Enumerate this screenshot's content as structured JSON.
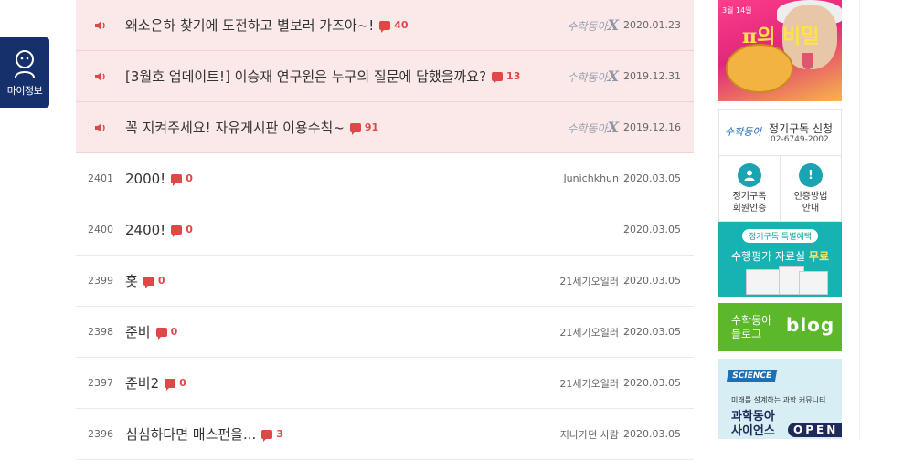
{
  "myinfo": {
    "label": "마이정보"
  },
  "notices": [
    {
      "title": "왜소은하 찾기에 도전하고 별보러 가즈아~!",
      "comments": "40",
      "date": "2020.01.23"
    },
    {
      "title": "[3월호 업데이트!] 이승재 연구원은 누구의 질문에 답했을까요?",
      "comments": "13",
      "date": "2019.12.31"
    },
    {
      "title": "꼭 지켜주세요! 자유게시판 이용수칙~",
      "comments": "91",
      "date": "2019.12.16"
    }
  ],
  "notice_logo": {
    "text": "수학동아",
    "mark": "X"
  },
  "posts": [
    {
      "num": "2401",
      "title": "2000!",
      "comments": "0",
      "author": "Junichkhun",
      "date": "2020.03.05"
    },
    {
      "num": "2400",
      "title": "2400!",
      "comments": "0",
      "author": "",
      "date": "2020.03.05"
    },
    {
      "num": "2399",
      "title": "홋",
      "comments": "0",
      "author": "21세기오일러",
      "date": "2020.03.05"
    },
    {
      "num": "2398",
      "title": "준비",
      "comments": "0",
      "author": "21세기오일러",
      "date": "2020.03.05"
    },
    {
      "num": "2397",
      "title": "준비2",
      "comments": "0",
      "author": "21세기오일러",
      "date": "2020.03.05"
    },
    {
      "num": "2396",
      "title": "심심하다면 매스펀을...",
      "comments": "3",
      "author": "지나가던 사람",
      "date": "2020.03.05"
    }
  ],
  "sidebar": {
    "cover": {
      "line1": "3월 14일",
      "line2": "π의 비밀",
      "pi": "π"
    },
    "subscription": {
      "brand": "수학동아",
      "title": "정기구독 신청",
      "phone": "02-6749-2002",
      "left": {
        "l1": "정기구독",
        "l2": "회원인증"
      },
      "right": {
        "l1": "인증방법",
        "l2": "안내"
      }
    },
    "perk": {
      "pill": "정기구독 특별혜택",
      "title_a": "수행평가 자료실 ",
      "title_b": "무료"
    },
    "blog": {
      "l1": "수학동아",
      "l2": "블로그",
      "word": "blog"
    },
    "science": {
      "badge": "SCIENCE",
      "sub": "미래를 설계하는 과학 커뮤니티",
      "t1": "과학동아",
      "t2": "사이언스",
      "open": "OPEN"
    }
  },
  "colors": {
    "notice_bg": "#fbe9e9",
    "accent": "#e04848",
    "myinfo_bg": "#16306b"
  }
}
